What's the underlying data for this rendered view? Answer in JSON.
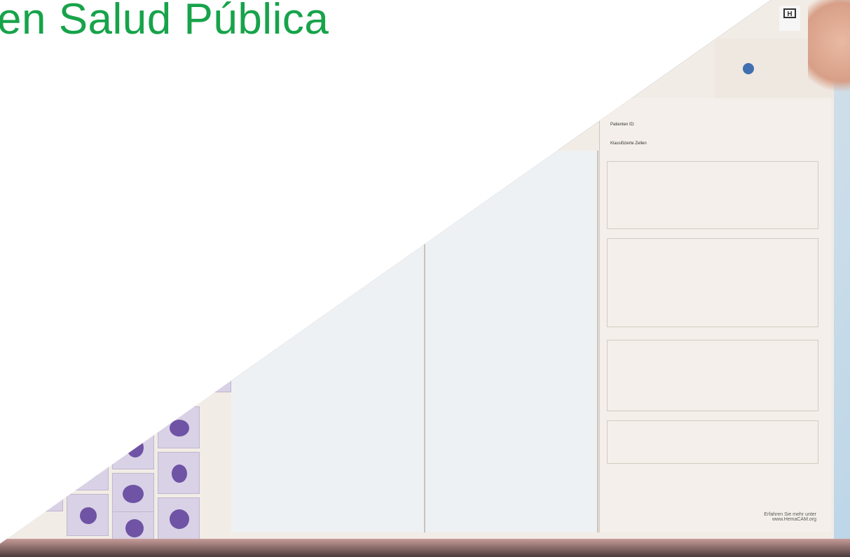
{
  "headline": "en Salud Pública",
  "accent_color": "#17a34a",
  "photo_description_alt": "",
  "screen": {
    "toolbar_label": "",
    "patient_label": "Patienten ID:",
    "classified_label": "Klassifizierte Zellen",
    "footer_line1": "Erfahren Sie mehr unter",
    "footer_line2": "www.HemaCAM.org"
  }
}
